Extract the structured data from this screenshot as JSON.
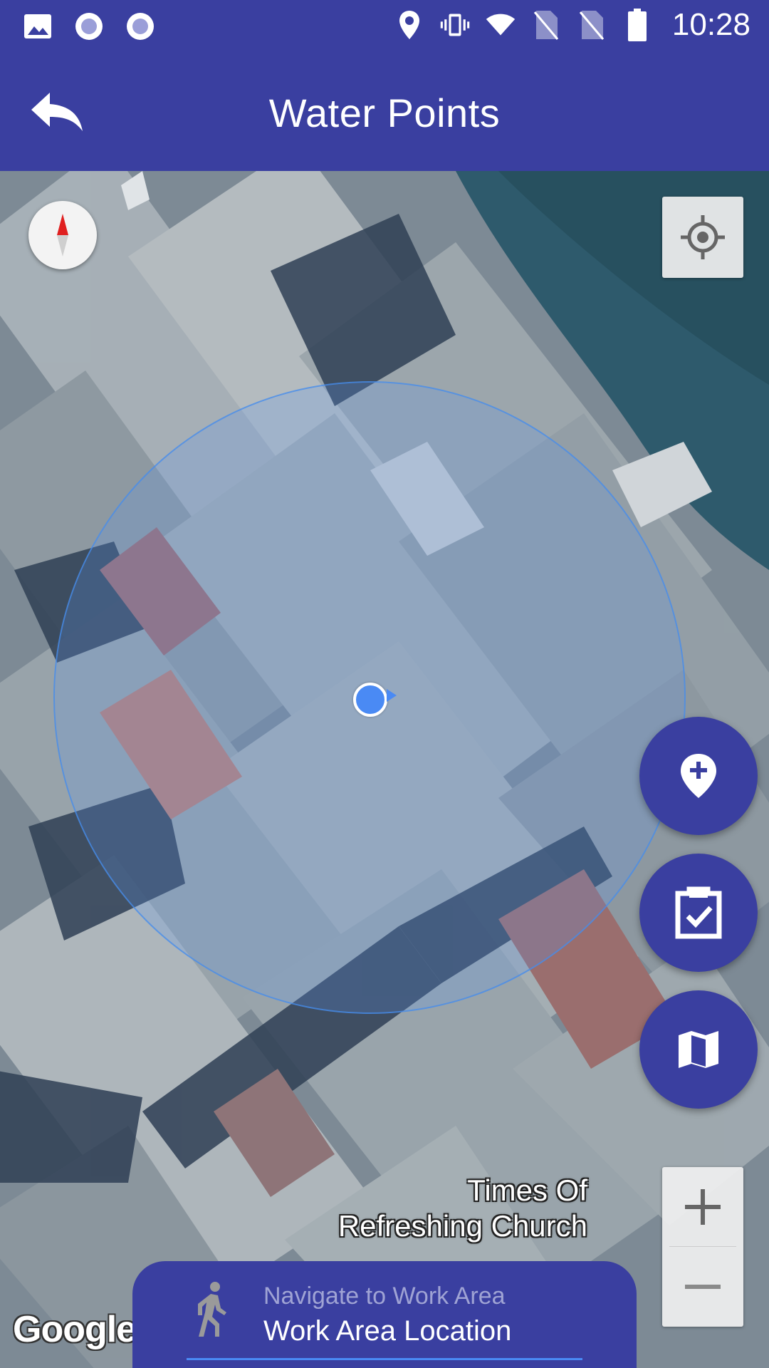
{
  "status_bar": {
    "time": "10:28",
    "left_icons": [
      "image-icon",
      "record-icon",
      "record-icon"
    ],
    "right_icons": [
      "location-pin-icon",
      "vibrate-icon",
      "wifi-icon",
      "no-sim-icon",
      "no-sim-icon",
      "battery-icon"
    ]
  },
  "app_bar": {
    "title": "Water Points",
    "back_icon": "reply-arrow-icon"
  },
  "map": {
    "poi_label_line1": "Times Of",
    "poi_label_line2": "Refreshing Church",
    "attribution": "Google",
    "zoom_in": "+",
    "zoom_out": "−"
  },
  "fabs": [
    {
      "name": "add-location-icon"
    },
    {
      "name": "clipboard-check-icon"
    },
    {
      "name": "map-icon"
    }
  ],
  "nav_field": {
    "hint": "Navigate to Work Area",
    "value": "Work Area Location",
    "icon": "walking-person-icon"
  },
  "colors": {
    "primary": "#3a3fa0",
    "accent": "#4a8af4"
  }
}
